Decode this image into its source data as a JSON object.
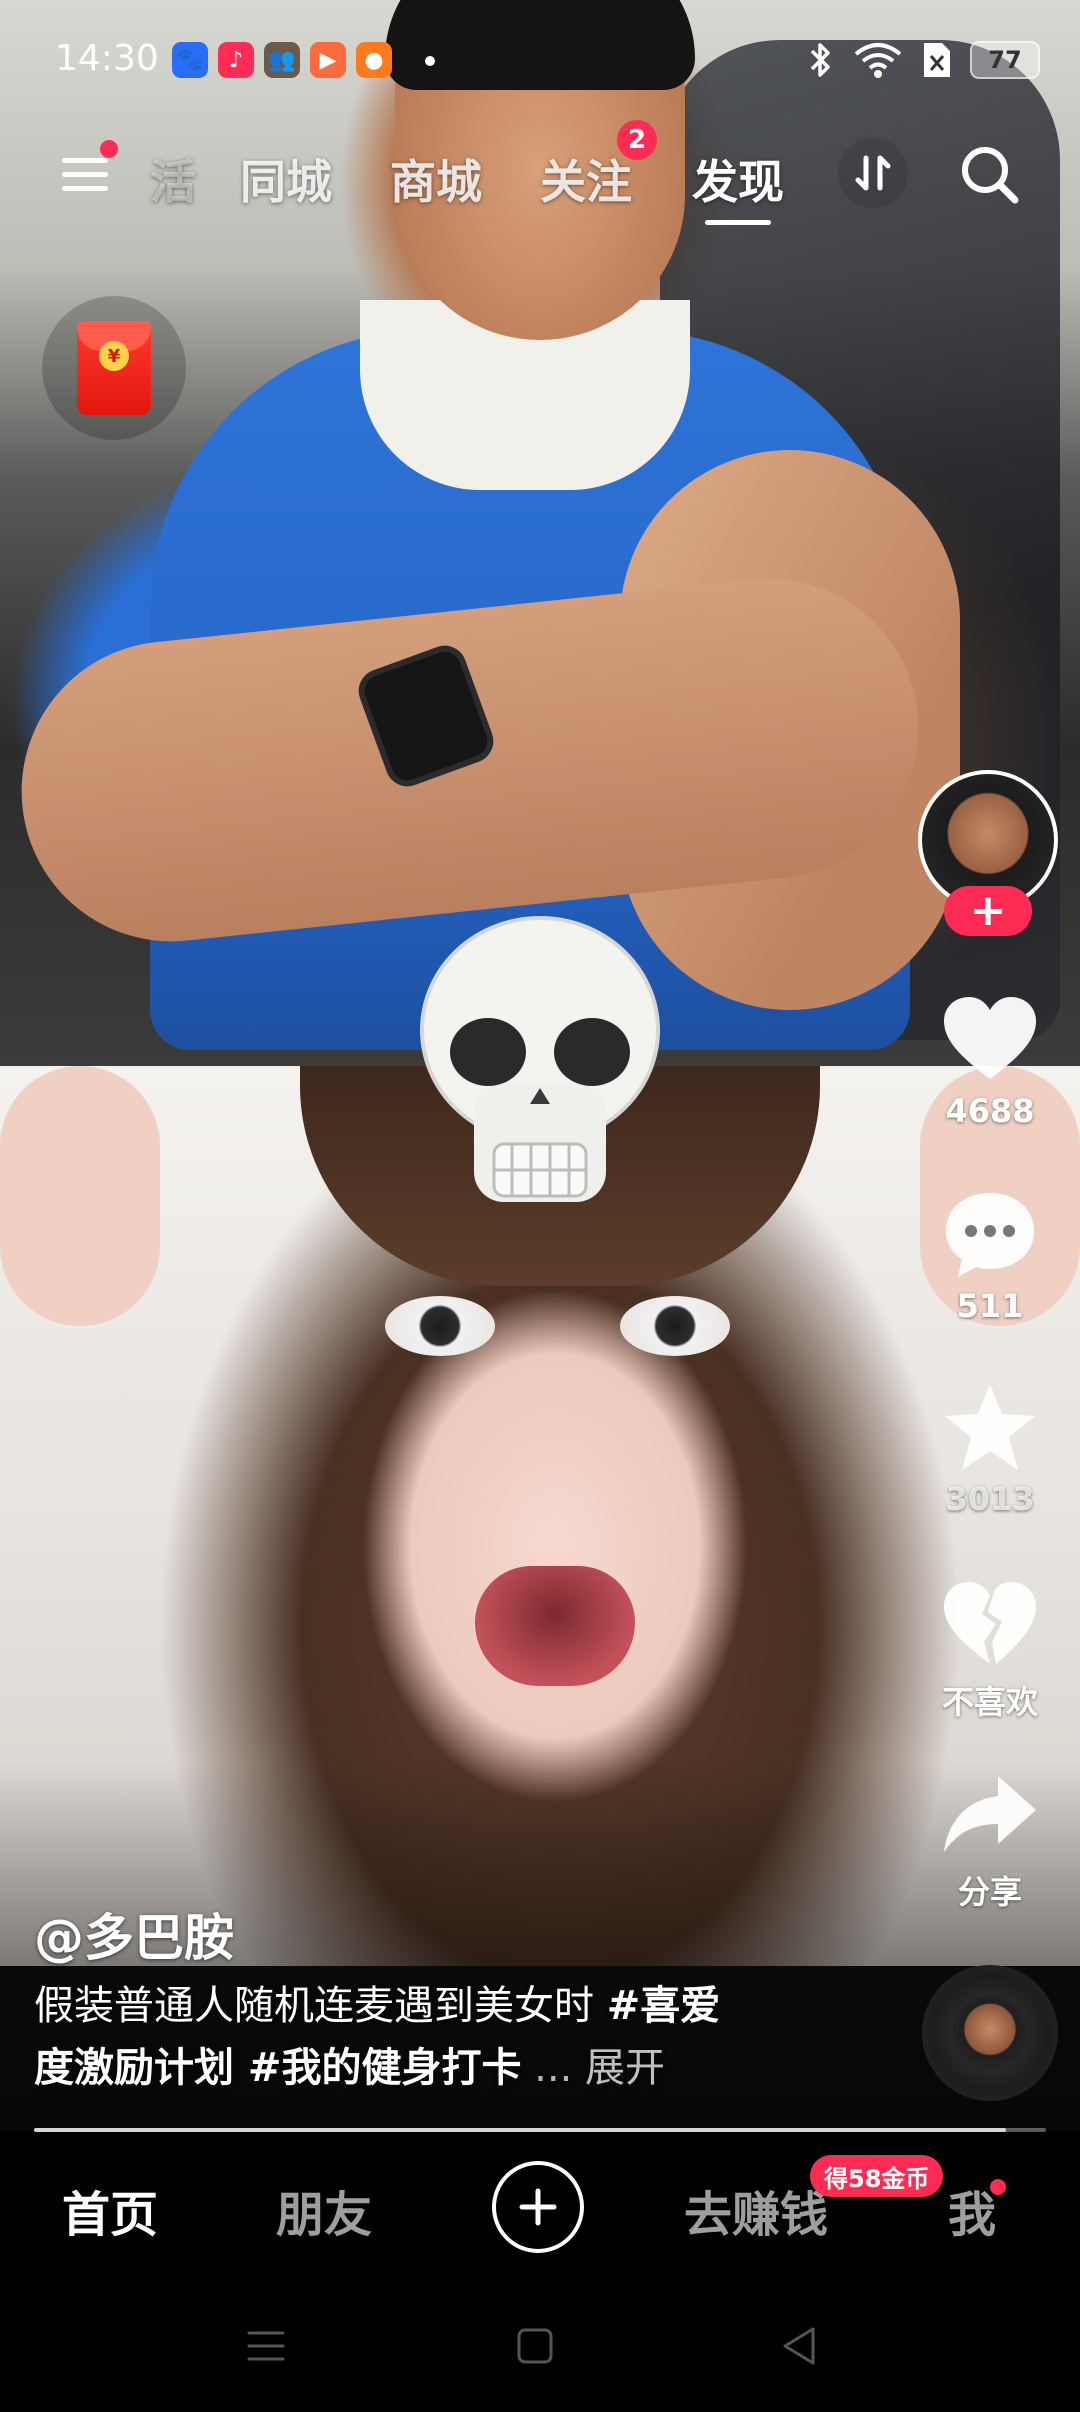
{
  "status_bar": {
    "time": "14:30",
    "battery": "77",
    "app_icons": [
      {
        "name": "baidu-app-icon",
        "color": "#2b6cf4",
        "glyph": "🐾"
      },
      {
        "name": "music-app-icon",
        "color": "#ff2d55",
        "glyph": "♪"
      },
      {
        "name": "game-app-icon",
        "color": "#6b5a4a",
        "glyph": "👥"
      },
      {
        "name": "toutiao-app-icon",
        "color": "#ff6a3d",
        "glyph": "▶"
      },
      {
        "name": "kuaishou-app-icon",
        "color": "#ff7a1a",
        "glyph": "●"
      }
    ]
  },
  "top_nav": {
    "tabs": [
      {
        "label": "活",
        "state": "partial"
      },
      {
        "label": "同城",
        "state": "normal"
      },
      {
        "label": "商城",
        "state": "normal"
      },
      {
        "label": "关注",
        "state": "normal"
      },
      {
        "label": "发现",
        "state": "active"
      }
    ],
    "follow_badge": "2"
  },
  "video": {
    "author": "@多巴胺",
    "caption": {
      "text": "假装普通人随机连麦遇到美女时 ",
      "tag1": "#喜爱度激励计划",
      "tag2": " #我的健身打卡",
      "ellipsis": " ...",
      "expand": " 展开"
    },
    "progress": 0.96
  },
  "actions": {
    "likes": "4688",
    "comments": "511",
    "favorites": "3013",
    "dislike": "不喜欢",
    "share": "分享"
  },
  "bottom_nav": {
    "home": "首页",
    "friends": "朋友",
    "earn": "去赚钱",
    "coin_badge": "得58金币",
    "me": "我"
  },
  "colors": {
    "accent": "#fe2c55",
    "background": "#000000"
  }
}
